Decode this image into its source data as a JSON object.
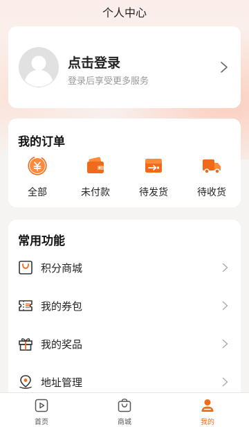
{
  "header": {
    "title": "个人中心"
  },
  "login": {
    "title": "点击登录",
    "subtitle": "登录后享受更多服务"
  },
  "orders": {
    "title": "我的订单",
    "items": [
      {
        "label": "全部",
        "icon": "all-orders-icon"
      },
      {
        "label": "未付款",
        "icon": "wallet-icon"
      },
      {
        "label": "待发货",
        "icon": "shipping-box-icon"
      },
      {
        "label": "待收货",
        "icon": "delivery-truck-icon"
      }
    ]
  },
  "functions": {
    "title": "常用功能",
    "items": [
      {
        "label": "积分商城",
        "icon": "shopping-bag-icon"
      },
      {
        "label": "我的券包",
        "icon": "coupon-icon"
      },
      {
        "label": "我的奖品",
        "icon": "gift-icon"
      },
      {
        "label": "地址管理",
        "icon": "location-pin-icon"
      }
    ]
  },
  "tabbar": {
    "items": [
      {
        "label": "首页",
        "icon": "home-play-icon"
      },
      {
        "label": "商城",
        "icon": "shopping-bag-icon"
      },
      {
        "label": "我的",
        "icon": "user-icon"
      }
    ],
    "active": "我的"
  },
  "colors": {
    "accent": "#f06a1b",
    "accent_light": "#ff8a3d",
    "text": "#222222",
    "muted": "#999999"
  }
}
